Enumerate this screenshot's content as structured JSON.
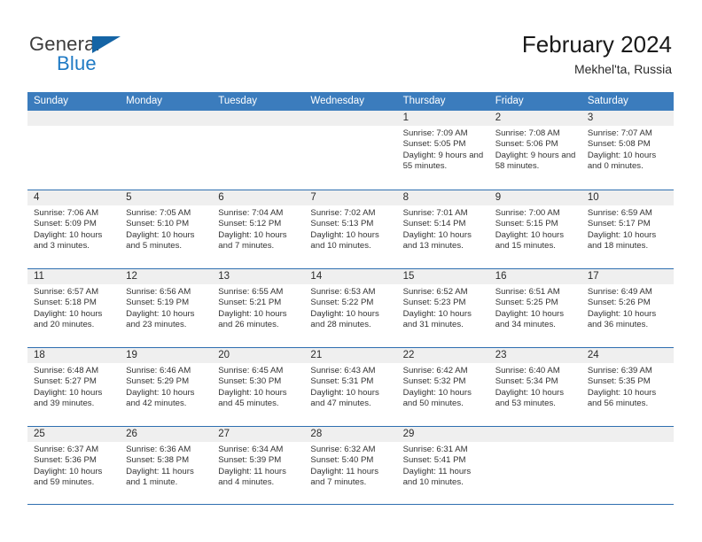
{
  "brand": {
    "name_top": "General",
    "name_bottom": "Blue",
    "triangle_color": "#1464a5",
    "blue_color": "#1f7ac4"
  },
  "header": {
    "title": "February 2024",
    "subtitle": "Mekhel'ta, Russia"
  },
  "theme": {
    "header_bg": "#3b7cbd",
    "separator": "#2f6fb0",
    "day_band_bg": "#efefef",
    "text": "#333333"
  },
  "weekdays": [
    "Sunday",
    "Monday",
    "Tuesday",
    "Wednesday",
    "Thursday",
    "Friday",
    "Saturday"
  ],
  "weeks": [
    [
      {
        "empty": true
      },
      {
        "empty": true
      },
      {
        "empty": true
      },
      {
        "empty": true
      },
      {
        "day": "1",
        "sunrise": "Sunrise: 7:09 AM",
        "sunset": "Sunset: 5:05 PM",
        "daylight": "Daylight: 9 hours and 55 minutes."
      },
      {
        "day": "2",
        "sunrise": "Sunrise: 7:08 AM",
        "sunset": "Sunset: 5:06 PM",
        "daylight": "Daylight: 9 hours and 58 minutes."
      },
      {
        "day": "3",
        "sunrise": "Sunrise: 7:07 AM",
        "sunset": "Sunset: 5:08 PM",
        "daylight": "Daylight: 10 hours and 0 minutes."
      }
    ],
    [
      {
        "day": "4",
        "sunrise": "Sunrise: 7:06 AM",
        "sunset": "Sunset: 5:09 PM",
        "daylight": "Daylight: 10 hours and 3 minutes."
      },
      {
        "day": "5",
        "sunrise": "Sunrise: 7:05 AM",
        "sunset": "Sunset: 5:10 PM",
        "daylight": "Daylight: 10 hours and 5 minutes."
      },
      {
        "day": "6",
        "sunrise": "Sunrise: 7:04 AM",
        "sunset": "Sunset: 5:12 PM",
        "daylight": "Daylight: 10 hours and 7 minutes."
      },
      {
        "day": "7",
        "sunrise": "Sunrise: 7:02 AM",
        "sunset": "Sunset: 5:13 PM",
        "daylight": "Daylight: 10 hours and 10 minutes."
      },
      {
        "day": "8",
        "sunrise": "Sunrise: 7:01 AM",
        "sunset": "Sunset: 5:14 PM",
        "daylight": "Daylight: 10 hours and 13 minutes."
      },
      {
        "day": "9",
        "sunrise": "Sunrise: 7:00 AM",
        "sunset": "Sunset: 5:15 PM",
        "daylight": "Daylight: 10 hours and 15 minutes."
      },
      {
        "day": "10",
        "sunrise": "Sunrise: 6:59 AM",
        "sunset": "Sunset: 5:17 PM",
        "daylight": "Daylight: 10 hours and 18 minutes."
      }
    ],
    [
      {
        "day": "11",
        "sunrise": "Sunrise: 6:57 AM",
        "sunset": "Sunset: 5:18 PM",
        "daylight": "Daylight: 10 hours and 20 minutes."
      },
      {
        "day": "12",
        "sunrise": "Sunrise: 6:56 AM",
        "sunset": "Sunset: 5:19 PM",
        "daylight": "Daylight: 10 hours and 23 minutes."
      },
      {
        "day": "13",
        "sunrise": "Sunrise: 6:55 AM",
        "sunset": "Sunset: 5:21 PM",
        "daylight": "Daylight: 10 hours and 26 minutes."
      },
      {
        "day": "14",
        "sunrise": "Sunrise: 6:53 AM",
        "sunset": "Sunset: 5:22 PM",
        "daylight": "Daylight: 10 hours and 28 minutes."
      },
      {
        "day": "15",
        "sunrise": "Sunrise: 6:52 AM",
        "sunset": "Sunset: 5:23 PM",
        "daylight": "Daylight: 10 hours and 31 minutes."
      },
      {
        "day": "16",
        "sunrise": "Sunrise: 6:51 AM",
        "sunset": "Sunset: 5:25 PM",
        "daylight": "Daylight: 10 hours and 34 minutes."
      },
      {
        "day": "17",
        "sunrise": "Sunrise: 6:49 AM",
        "sunset": "Sunset: 5:26 PM",
        "daylight": "Daylight: 10 hours and 36 minutes."
      }
    ],
    [
      {
        "day": "18",
        "sunrise": "Sunrise: 6:48 AM",
        "sunset": "Sunset: 5:27 PM",
        "daylight": "Daylight: 10 hours and 39 minutes."
      },
      {
        "day": "19",
        "sunrise": "Sunrise: 6:46 AM",
        "sunset": "Sunset: 5:29 PM",
        "daylight": "Daylight: 10 hours and 42 minutes."
      },
      {
        "day": "20",
        "sunrise": "Sunrise: 6:45 AM",
        "sunset": "Sunset: 5:30 PM",
        "daylight": "Daylight: 10 hours and 45 minutes."
      },
      {
        "day": "21",
        "sunrise": "Sunrise: 6:43 AM",
        "sunset": "Sunset: 5:31 PM",
        "daylight": "Daylight: 10 hours and 47 minutes."
      },
      {
        "day": "22",
        "sunrise": "Sunrise: 6:42 AM",
        "sunset": "Sunset: 5:32 PM",
        "daylight": "Daylight: 10 hours and 50 minutes."
      },
      {
        "day": "23",
        "sunrise": "Sunrise: 6:40 AM",
        "sunset": "Sunset: 5:34 PM",
        "daylight": "Daylight: 10 hours and 53 minutes."
      },
      {
        "day": "24",
        "sunrise": "Sunrise: 6:39 AM",
        "sunset": "Sunset: 5:35 PM",
        "daylight": "Daylight: 10 hours and 56 minutes."
      }
    ],
    [
      {
        "day": "25",
        "sunrise": "Sunrise: 6:37 AM",
        "sunset": "Sunset: 5:36 PM",
        "daylight": "Daylight: 10 hours and 59 minutes."
      },
      {
        "day": "26",
        "sunrise": "Sunrise: 6:36 AM",
        "sunset": "Sunset: 5:38 PM",
        "daylight": "Daylight: 11 hours and 1 minute."
      },
      {
        "day": "27",
        "sunrise": "Sunrise: 6:34 AM",
        "sunset": "Sunset: 5:39 PM",
        "daylight": "Daylight: 11 hours and 4 minutes."
      },
      {
        "day": "28",
        "sunrise": "Sunrise: 6:32 AM",
        "sunset": "Sunset: 5:40 PM",
        "daylight": "Daylight: 11 hours and 7 minutes."
      },
      {
        "day": "29",
        "sunrise": "Sunrise: 6:31 AM",
        "sunset": "Sunset: 5:41 PM",
        "daylight": "Daylight: 11 hours and 10 minutes."
      },
      {
        "empty": true
      },
      {
        "empty": true
      }
    ]
  ]
}
